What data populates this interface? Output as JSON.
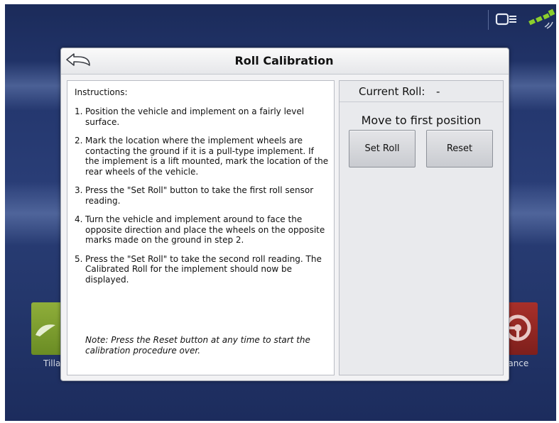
{
  "dialog": {
    "title": "Roll Calibration",
    "back_icon": "back-arrow-icon"
  },
  "instructions": {
    "heading": "Instructions:",
    "steps": [
      {
        "num": "1.",
        "text": "Position the vehicle and implement on a fairly level surface."
      },
      {
        "num": "2.",
        "text": "Mark the location where the implement wheels are contacting the ground if it is a pull-type implement. If the implement is a lift mounted, mark the location of the rear wheels of the vehicle."
      },
      {
        "num": "3.",
        "text": "Press the \"Set Roll\" button to take the first roll sensor reading."
      },
      {
        "num": "4.",
        "text": "Turn the vehicle and implement around to face the opposite direction and place the wheels on the opposite marks made on the ground in step 2."
      },
      {
        "num": "5.",
        "text": "Press the \"Set Roll\" to take the second roll reading. The Calibrated Roll for the implement should now be displayed."
      }
    ],
    "note": "Note: Press the Reset button at any time to start the calibration procedure over."
  },
  "panel": {
    "current_roll_label": "Current Roll:",
    "current_roll_value": "-",
    "status": "Move to first position",
    "set_roll_label": "Set Roll",
    "reset_label": "Reset"
  },
  "background": {
    "left_tile_label": "Tilla",
    "right_tile_label": "lance"
  },
  "status_icons": [
    "gps-receiver-icon",
    "satellite-signal-icon"
  ],
  "colors": {
    "screen_bg": "#23366d",
    "dialog_bg": "#f2f2f4",
    "left_tile": "#7a9c2e",
    "right_tile": "#8f2824"
  }
}
